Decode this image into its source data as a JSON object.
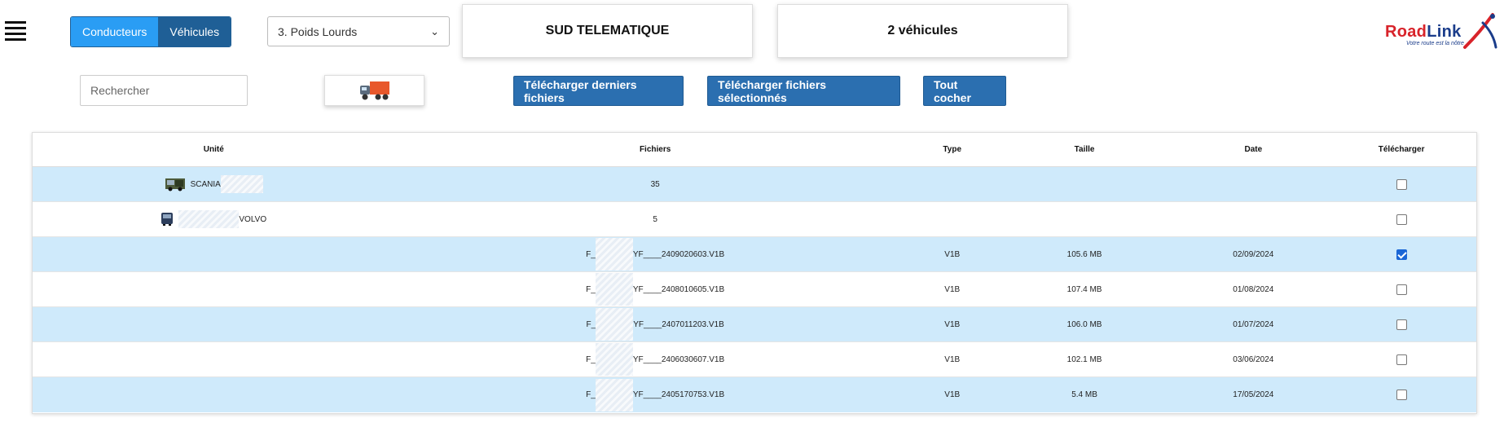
{
  "header": {
    "toggle": {
      "drivers_label": "Conducteurs",
      "vehicles_label": "Véhicules"
    },
    "fleet_select": {
      "selected": "3. Poids Lourds"
    },
    "company_card": "SUD TELEMATIQUE",
    "count_card": "2 véhicules",
    "logo": {
      "brand_red": "Road",
      "brand_blue": "Link",
      "tagline": "Votre route est la nôtre"
    }
  },
  "toolbar": {
    "search_placeholder": "Rechercher",
    "download_last_label": "Télécharger derniers fichiers",
    "download_selected_label": "Télécharger fichiers sélectionnés",
    "check_all_label": "Tout cocher"
  },
  "table": {
    "headers": {
      "unit": "Unité",
      "files": "Fichiers",
      "type": "Type",
      "size": "Taille",
      "date": "Date",
      "download": "Télécharger"
    },
    "vehicles": [
      {
        "name_prefix": "SCANIA",
        "name_suffix": "",
        "files": "35"
      },
      {
        "name_prefix": "",
        "name_suffix": "VOLVO",
        "files": "5"
      }
    ],
    "files": [
      {
        "prefix": "F_",
        "suffix": "YF____2409020603.V1B",
        "type": "V1B",
        "size": "105.6 MB",
        "date": "02/09/2024",
        "checked": true
      },
      {
        "prefix": "F_",
        "suffix": "YF____2408010605.V1B",
        "type": "V1B",
        "size": "107.4 MB",
        "date": "01/08/2024",
        "checked": false
      },
      {
        "prefix": "F_",
        "suffix": "YF____2407011203.V1B",
        "type": "V1B",
        "size": "106.0 MB",
        "date": "01/07/2024",
        "checked": false
      },
      {
        "prefix": "F_",
        "suffix": "YF____2406030607.V1B",
        "type": "V1B",
        "size": "102.1 MB",
        "date": "03/06/2024",
        "checked": false
      },
      {
        "prefix": "F_",
        "suffix": "YF____2405170753.V1B",
        "type": "V1B",
        "size": "5.4 MB",
        "date": "17/05/2024",
        "checked": false
      }
    ]
  },
  "colors": {
    "toggle_active": "#2a9df4",
    "toggle_inactive": "#1f5f96",
    "action_button": "#2b6fb0",
    "row_highlight": "#cfeafb",
    "logo_red": "#d8232a",
    "logo_blue": "#1a3c8a"
  }
}
